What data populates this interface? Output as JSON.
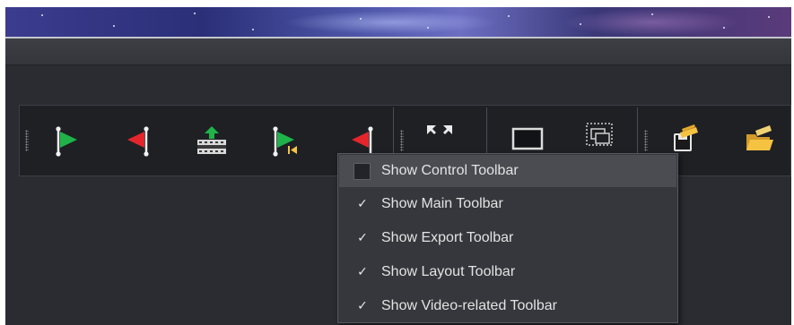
{
  "toolbars": {
    "control": {
      "buttons": [
        {
          "icon": "green-flag-start-marker-icon"
        },
        {
          "icon": "red-flag-end-marker-icon"
        },
        {
          "icon": "film-insert-icon"
        },
        {
          "icon": "green-flag-go-to-start-icon"
        },
        {
          "icon": "red-flag-go-to-end-icon"
        }
      ]
    },
    "layout": {
      "buttons": [
        {
          "icon": "fullscreen-expand-icon"
        },
        {
          "icon": "single-window-icon"
        },
        {
          "icon": "multi-window-icon"
        }
      ]
    },
    "project": {
      "buttons": [
        {
          "icon": "save-project-icon"
        },
        {
          "icon": "open-project-folder-icon"
        }
      ]
    }
  },
  "context_menu": {
    "items": [
      {
        "label": "Show Control Toolbar",
        "checked": false,
        "highlighted": true
      },
      {
        "label": "Show Main Toolbar",
        "checked": true,
        "highlighted": false
      },
      {
        "label": "Show Export Toolbar",
        "checked": true,
        "highlighted": false
      },
      {
        "label": "Show Layout Toolbar",
        "checked": true,
        "highlighted": false
      },
      {
        "label": "Show Video-related Toolbar",
        "checked": true,
        "highlighted": false
      }
    ],
    "check_glyph": "✓"
  },
  "colors": {
    "panel": "#2a2c31",
    "toolbar": "#1e2024",
    "menu": "#35373c",
    "menu_highlight": "#4a4c52",
    "flag_green": "#1fb34a",
    "flag_red": "#e2262b",
    "flag_pole": "#f2f2f2",
    "folder_yellow": "#f5c242"
  }
}
